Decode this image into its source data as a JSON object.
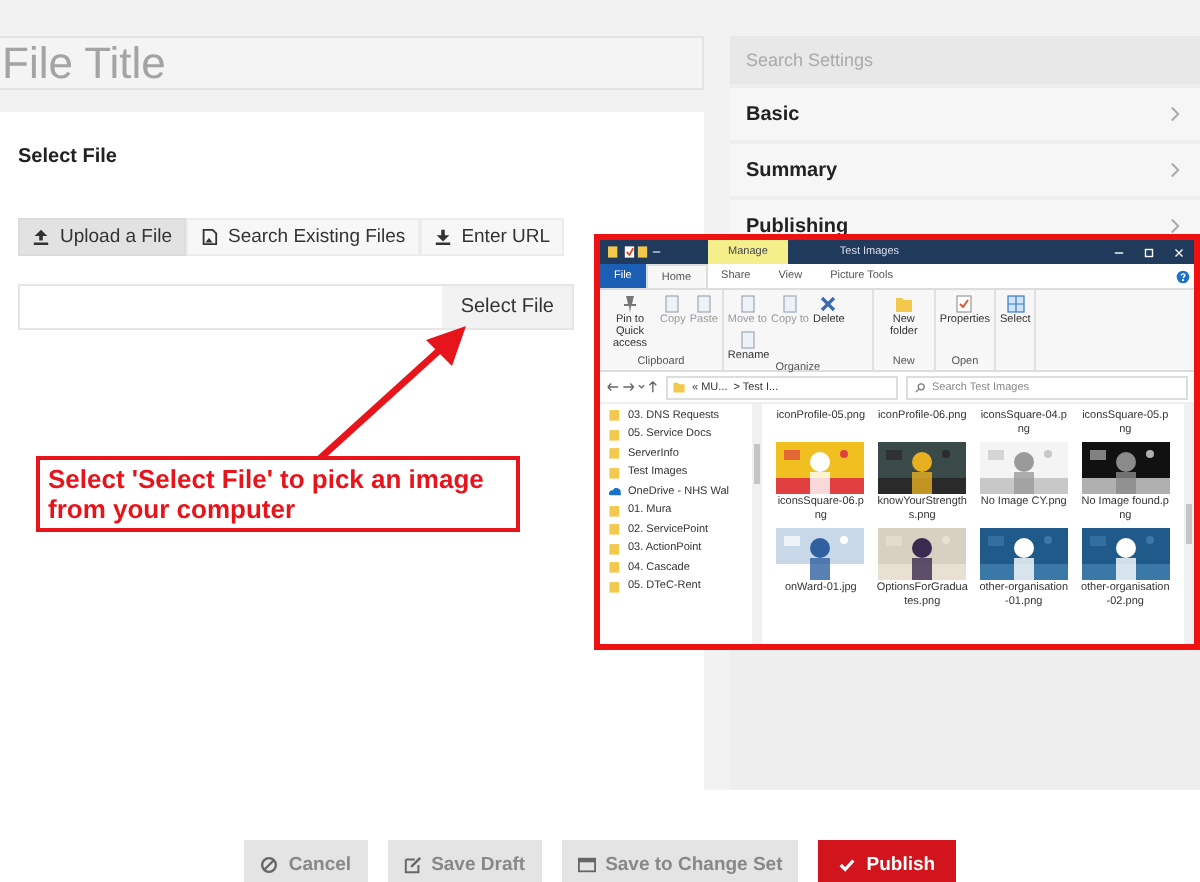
{
  "title_field": {
    "placeholder": "File Title"
  },
  "section_title": "Select File",
  "tabs": [
    {
      "label": "Upload a File",
      "selected": true
    },
    {
      "label": "Search Existing Files",
      "selected": false
    },
    {
      "label": "Enter URL",
      "selected": false
    }
  ],
  "file_input": {
    "button": "Select File"
  },
  "settings": {
    "header": "Search Settings",
    "sections": [
      "Basic",
      "Summary",
      "Publishing"
    ]
  },
  "actions": [
    {
      "label": "Cancel",
      "kind": "cancel"
    },
    {
      "label": "Save Draft",
      "kind": "draft"
    },
    {
      "label": "Save to Change Set",
      "kind": "changeset"
    },
    {
      "label": "Publish",
      "kind": "publish"
    }
  ],
  "callout": {
    "text": "Select 'Select File' to pick an image from your computer"
  },
  "explorer": {
    "context_tab": "Manage",
    "title": "Test Images",
    "ribbon_tabs": [
      {
        "label": "File",
        "kind": "menu",
        "selected": false
      },
      {
        "label": "Home",
        "kind": "tab",
        "selected": true
      },
      {
        "label": "Share",
        "kind": "tab",
        "selected": false
      },
      {
        "label": "View",
        "kind": "tab",
        "selected": false
      },
      {
        "label": "Picture Tools",
        "kind": "tab",
        "selected": false
      }
    ],
    "groups": [
      {
        "label": "Clipboard",
        "commands": [
          {
            "label": "Pin to Quick access",
            "disabled": false
          },
          {
            "label": "Copy",
            "disabled": true
          },
          {
            "label": "Paste",
            "disabled": true
          }
        ]
      },
      {
        "label": "Organize",
        "commands": [
          {
            "label": "Move to",
            "disabled": true
          },
          {
            "label": "Copy to",
            "disabled": true
          },
          {
            "label": "Delete",
            "disabled": false
          },
          {
            "label": "Rename",
            "disabled": false
          }
        ]
      },
      {
        "label": "New",
        "commands": [
          {
            "label": "New folder",
            "disabled": false
          }
        ]
      },
      {
        "label": "Open",
        "commands": [
          {
            "label": "Properties",
            "disabled": false
          }
        ]
      },
      {
        "commands": [
          {
            "label": "Select",
            "disabled": false
          }
        ]
      }
    ],
    "path": [
      "« MU...",
      "> Test I..."
    ],
    "search_placeholder": "Search Test Images",
    "nav": [
      {
        "label": "03. DNS Requests",
        "kind": "folder"
      },
      {
        "label": "05. Service Docs",
        "kind": "folder"
      },
      {
        "label": "ServerInfo",
        "kind": "folder"
      },
      {
        "label": "Test Images",
        "kind": "folder"
      },
      {
        "label": "OneDrive - NHS Wal",
        "kind": "cloud"
      },
      {
        "label": "01. Mura",
        "kind": "folder"
      },
      {
        "label": "02. ServicePoint",
        "kind": "folder"
      },
      {
        "label": "03. ActionPoint",
        "kind": "folder"
      },
      {
        "label": "04. Cascade",
        "kind": "folder"
      },
      {
        "label": "05. DTeC-Rent",
        "kind": "folder"
      }
    ],
    "files": [
      {
        "name": "iconProfile-05.png",
        "kind": "clipped"
      },
      {
        "name": "iconProfile-06.png",
        "kind": "clipped"
      },
      {
        "name": "iconsSquare-04.png",
        "kind": "clipped"
      },
      {
        "name": "iconsSquare-05.png",
        "kind": "clipped"
      },
      {
        "name": "iconsSquare-06.png",
        "kind": "picture"
      },
      {
        "name": "knowYourStrengths.png",
        "kind": "picture"
      },
      {
        "name": "No Image CY.png",
        "kind": "picture"
      },
      {
        "name": "No Image found.png",
        "kind": "picture"
      },
      {
        "name": "onWard-01.jpg",
        "kind": "picture"
      },
      {
        "name": "OptionsForGraduates.png",
        "kind": "picture"
      },
      {
        "name": "other-organisation-01.png",
        "kind": "picture"
      },
      {
        "name": "other-organisation-02.png",
        "kind": "picture"
      }
    ]
  }
}
